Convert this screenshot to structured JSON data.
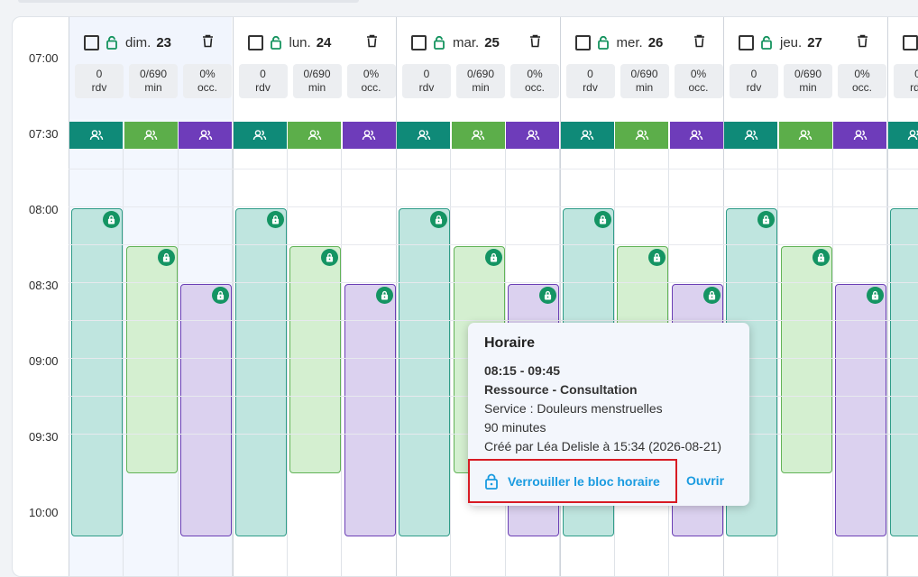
{
  "times": [
    "07:00",
    "07:30",
    "08:00",
    "08:30",
    "09:00",
    "09:30",
    "10:00"
  ],
  "days": [
    {
      "name": "dim.",
      "num": "23",
      "selected": true
    },
    {
      "name": "lun.",
      "num": "24",
      "selected": false
    },
    {
      "name": "mar.",
      "num": "25",
      "selected": false
    },
    {
      "name": "mer.",
      "num": "26",
      "selected": false
    },
    {
      "name": "jeu.",
      "num": "27",
      "selected": false
    },
    {
      "name": "",
      "num": "",
      "selected": false
    }
  ],
  "stats": {
    "rdv_value": "0",
    "rdv_label": "rdv",
    "min_value": "0/690",
    "min_label": "min",
    "occ_value": "0%",
    "occ_label": "occ."
  },
  "resource_colors": {
    "teal": "#0f8a78",
    "green": "#5cae4a",
    "purple": "#6e3cba"
  },
  "icons": {
    "resource": "people-icon",
    "lock": "lock-icon",
    "delete": "trash-icon",
    "checkbox": "checkbox-icon"
  },
  "tooltip": {
    "title": "Horaire",
    "time": "08:15 - 09:45",
    "resource": "Ressource - Consultation",
    "service": "Service : Douleurs menstruelles",
    "duration": "90 minutes",
    "created": "Créé par Léa Delisle à 15:34 (2026-08-21)",
    "lock_label": "Verrouiller le bloc horaire",
    "open_label": "Ouvrir"
  }
}
